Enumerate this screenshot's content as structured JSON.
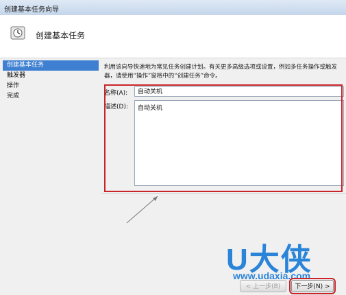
{
  "window": {
    "title": "创建基本任务向导"
  },
  "header": {
    "title": "创建基本任务"
  },
  "sidebar": {
    "items": [
      {
        "label": "创建基本任务"
      },
      {
        "label": "触发器"
      },
      {
        "label": "操作"
      },
      {
        "label": "完成"
      }
    ]
  },
  "content": {
    "description": "利用该向导快速地为常见任务创建计划。有关更多高级选项或设置，例如多任务操作或触发器，请使用“操作”窗格中的“创建任务”命令。",
    "name_label": "名称(A):",
    "name_value": "自动关机",
    "desc_label": "描述(D):",
    "desc_value": "自动关机"
  },
  "footer": {
    "back_label": "< 上一步(B)",
    "next_label": "下一步(N) >"
  },
  "watermark": {
    "text": "U大侠",
    "url": "www.udaxia.com"
  },
  "colors": {
    "accent": "#3e7fd1",
    "highlight": "#c9242a",
    "watermark": "#2a84d8"
  }
}
